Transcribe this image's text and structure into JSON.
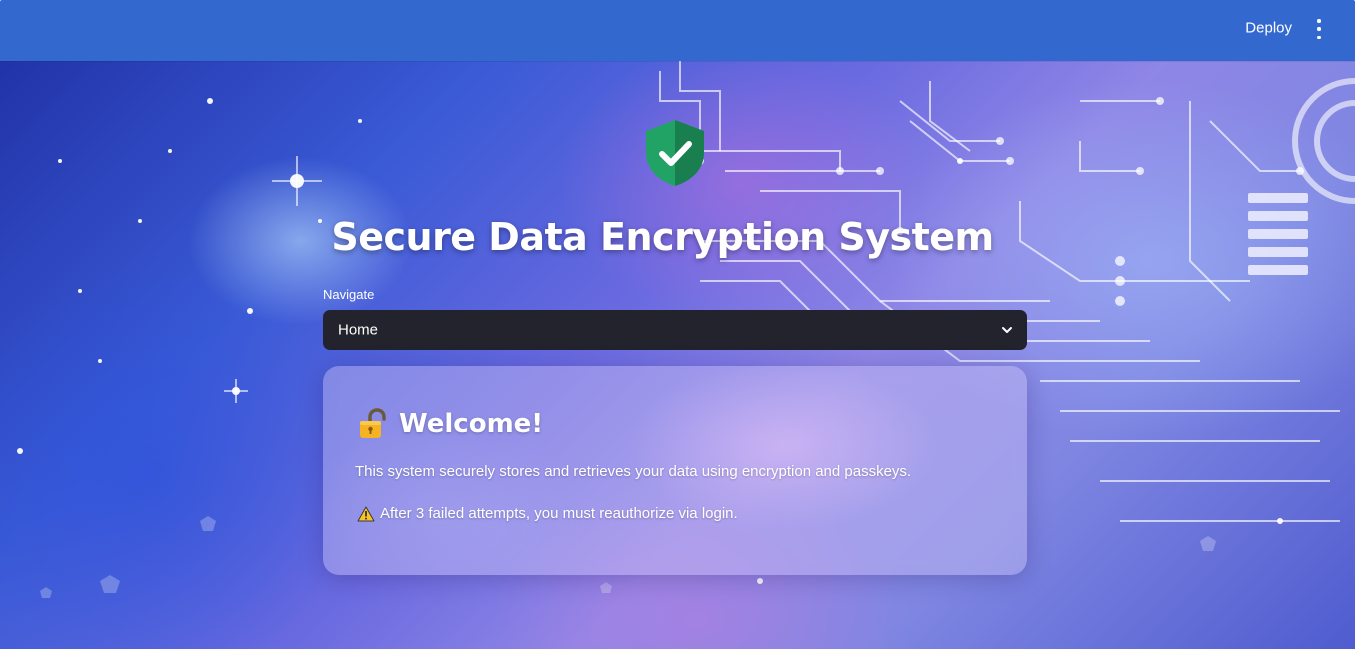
{
  "header": {
    "deploy_label": "Deploy",
    "menu_icon": "kebab-menu-icon",
    "bar_color": "#3369cf"
  },
  "hero": {
    "icon": "shield-check-icon",
    "title": "Secure Data Encryption System"
  },
  "navigation": {
    "label": "Navigate",
    "selected": "Home",
    "chevron_icon": "chevron-down-icon"
  },
  "welcome_card": {
    "icon": "lock-icon",
    "heading": "Welcome!",
    "description": "This system securely stores and retrieves your data using encryption and passkeys.",
    "warning_icon": "warning-icon",
    "warning": "After 3 failed attempts, you must reauthorize via login."
  },
  "colors": {
    "shield_green": "#21a366",
    "select_bg": "#23232e"
  }
}
